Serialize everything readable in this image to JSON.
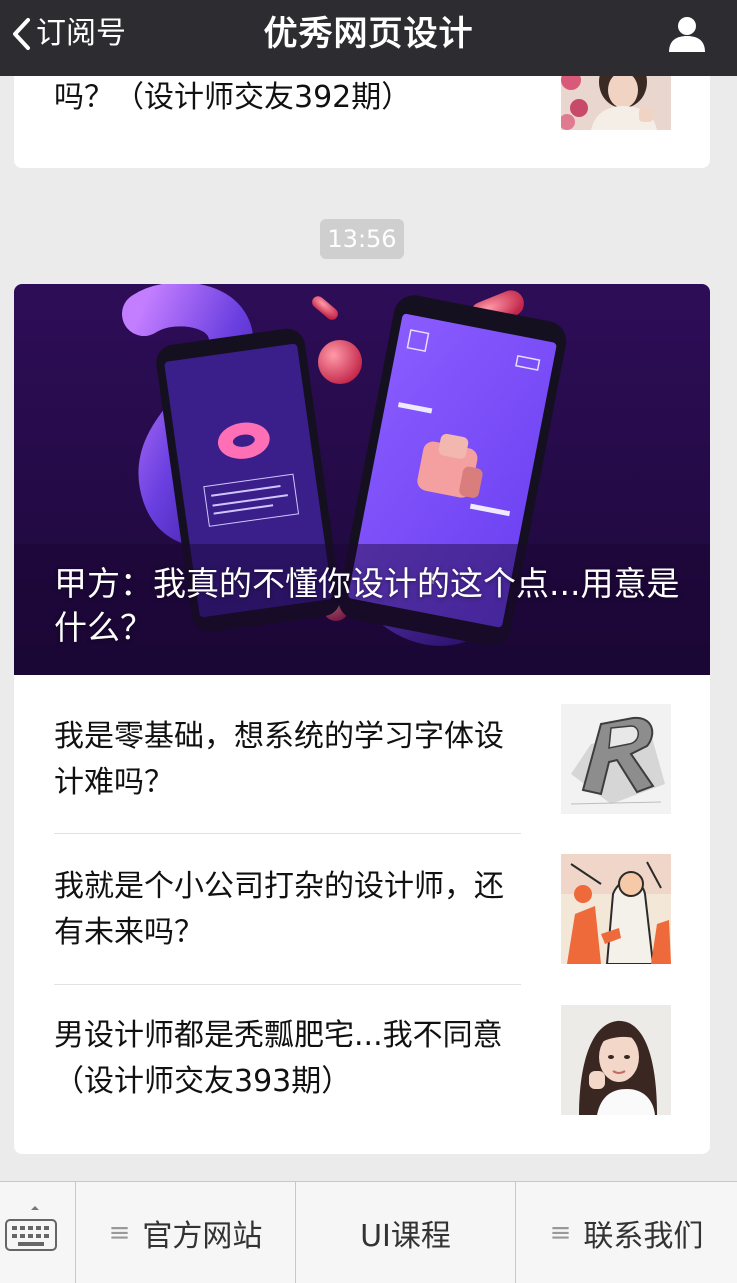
{
  "header": {
    "back_label": "订阅号",
    "title": "优秀网页设计"
  },
  "top_article": {
    "title_tail": "吗？（设计师交友392期）"
  },
  "timestamp": "13:56",
  "main_article": {
    "title": "甲方：我真的不懂你设计的这个点...用意是什么？"
  },
  "sub_articles": [
    {
      "title": "我是零基础，想系统的学习字体设计难吗？"
    },
    {
      "title": "我就是个小公司打杂的设计师，还有未来吗？"
    },
    {
      "title": "男设计师都是秃瓢肥宅...我不同意（设计师交友393期）"
    }
  ],
  "bottom_menu": [
    {
      "label": "官方网站",
      "has_submenu": true
    },
    {
      "label": "UI课程",
      "has_submenu": false
    },
    {
      "label": "联系我们",
      "has_submenu": true
    }
  ],
  "colors": {
    "header_bg": "#2d2c30",
    "page_bg": "#ebebeb",
    "hero_bg": "#2a0c4e",
    "accent_purple": "#7a4ff0"
  }
}
